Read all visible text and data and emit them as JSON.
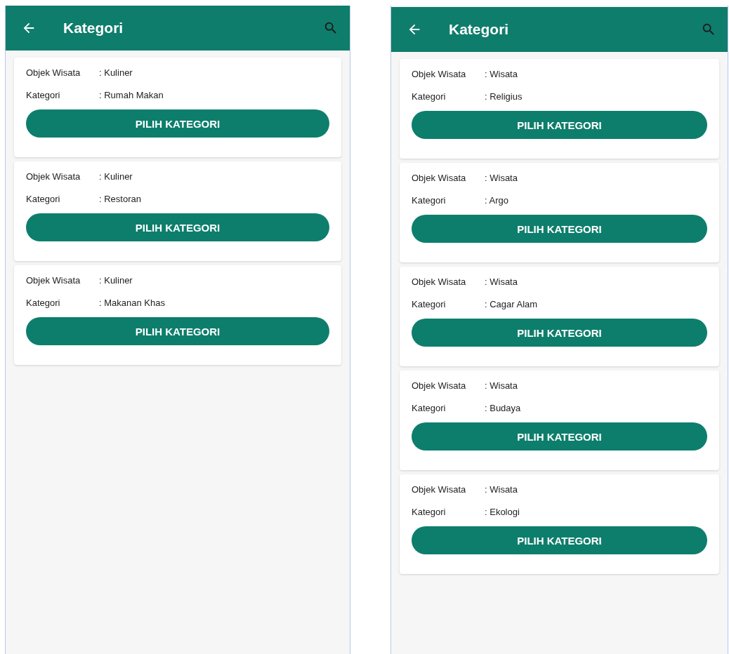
{
  "screens": [
    {
      "title": "Kategori",
      "cards": [
        {
          "rows": [
            {
              "label": "Objek Wisata",
              "value": ": Kuliner"
            },
            {
              "label": "Kategori",
              "value": ": Rumah Makan"
            }
          ],
          "button": "PILIH KATEGORI"
        },
        {
          "rows": [
            {
              "label": "Objek Wisata",
              "value": ": Kuliner"
            },
            {
              "label": "Kategori",
              "value": ": Restoran"
            }
          ],
          "button": "PILIH KATEGORI"
        },
        {
          "rows": [
            {
              "label": "Objek Wisata",
              "value": ": Kuliner"
            },
            {
              "label": "Kategori",
              "value": ": Makanan Khas"
            }
          ],
          "button": "PILIH KATEGORI"
        }
      ]
    },
    {
      "title": "Kategori",
      "cards": [
        {
          "rows": [
            {
              "label": "Objek Wisata",
              "value": ": Wisata"
            },
            {
              "label": "Kategori",
              "value": ": Religius"
            }
          ],
          "button": "PILIH KATEGORI"
        },
        {
          "rows": [
            {
              "label": "Objek Wisata",
              "value": ": Wisata"
            },
            {
              "label": "Kategori",
              "value": ": Argo"
            }
          ],
          "button": "PILIH KATEGORI"
        },
        {
          "rows": [
            {
              "label": "Objek Wisata",
              "value": ": Wisata"
            },
            {
              "label": "Kategori",
              "value": ": Cagar Alam"
            }
          ],
          "button": "PILIH KATEGORI"
        },
        {
          "rows": [
            {
              "label": "Objek Wisata",
              "value": ": Wisata"
            },
            {
              "label": "Kategori",
              "value": ": Budaya"
            }
          ],
          "button": "PILIH KATEGORI"
        },
        {
          "rows": [
            {
              "label": "Objek Wisata",
              "value": ": Wisata"
            },
            {
              "label": "Kategori",
              "value": ": Ekologi"
            }
          ],
          "button": "PILIH KATEGORI"
        }
      ]
    }
  ]
}
